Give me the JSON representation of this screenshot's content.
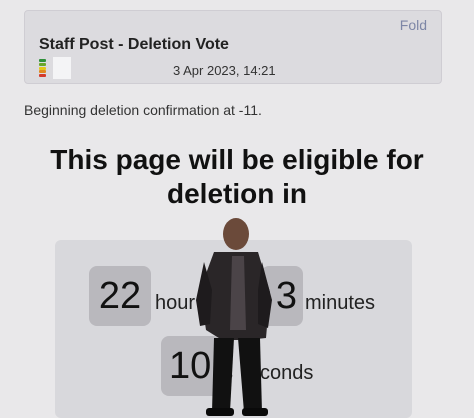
{
  "post": {
    "title": "Staff Post - Deletion Vote",
    "fold_label": "Fold",
    "date": "3 Apr 2023, 14:21"
  },
  "vote_icon": {
    "name": "vote-level-icon",
    "colors": [
      "#d43a2a",
      "#e08a1e",
      "#e3c81a",
      "#6aa72a",
      "#2f8f3a"
    ]
  },
  "status": {
    "text": "Beginning deletion confirmation at -11."
  },
  "headline": {
    "line1": "This page will be eligible for",
    "line2": "deletion in"
  },
  "countdown": {
    "hours_value": "22",
    "hours_label": "hour",
    "minutes_value": "3",
    "minutes_label": "minutes",
    "seconds_value": "10",
    "seconds_label_start": "s",
    "seconds_label_end": "conds"
  },
  "colors": {
    "fold_link": "#7d86a6",
    "panel_bg": "#d8d8dc",
    "number_box": "#b9b8bd"
  }
}
